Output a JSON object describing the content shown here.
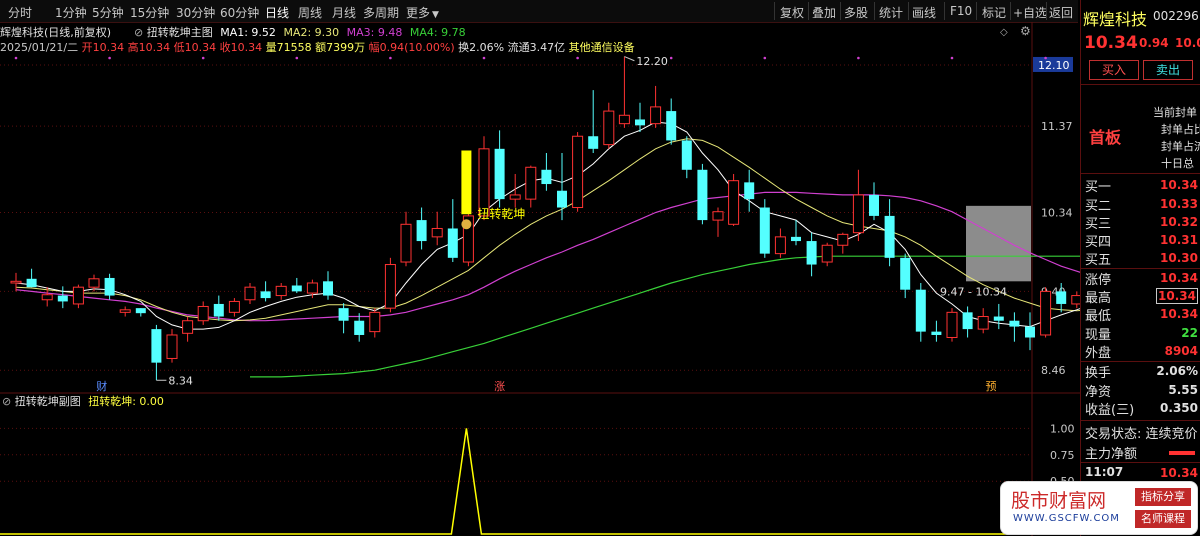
{
  "toolbar": {
    "periods": [
      "分时",
      "1分钟",
      "5分钟",
      "15分钟",
      "30分钟",
      "60分钟",
      "日线",
      "周线",
      "月线",
      "多周期",
      "更多"
    ],
    "active_period": "日线",
    "tools": [
      "复权",
      "叠加",
      "多股",
      "统计",
      "画线",
      "F10",
      "标记",
      "+自选",
      "返回"
    ]
  },
  "info": {
    "name_line": "辉煌科技(日线,前复权)",
    "date": "2025/01/21/二",
    "open": "开10.34",
    "high": "高10.34",
    "low": "低10.34",
    "close": "收10.34",
    "volume": "量71558",
    "amount": "额7399万",
    "change": "幅0.94(10.00%)",
    "turnover": "换2.06%",
    "float": "流通3.47亿",
    "sector": "其他通信设备"
  },
  "main_indicator": {
    "name": "扭转乾坤主图",
    "ma1": "MA1: 9.52",
    "ma2": "MA2: 9.30",
    "ma3": "MA3: 9.48",
    "ma4": "MA4: 9.78"
  },
  "sub_indicator": {
    "name": "扭转乾坤副图",
    "value_label": "扭转乾坤: 0.00"
  },
  "colors": {
    "up": "#ff3232",
    "down": "#54ffff",
    "ma1": "#ffffff",
    "ma2": "#e6e678",
    "ma3": "#d040d0",
    "ma4": "#38d038",
    "signal": "#ffff00",
    "grid": "#5a0f0f",
    "axis_text": "#c8c8c8"
  },
  "chart_data": {
    "type": "candlestick",
    "y_ticks": [
      "12.10",
      "11.37",
      "10.34",
      "9.40",
      "8.46"
    ],
    "y_tick_values": [
      12.1,
      11.37,
      10.34,
      9.4,
      8.46
    ],
    "ylim": [
      8.2,
      12.35
    ],
    "last_price_label": "12.10",
    "high_annotation": "12.20",
    "low_annotation": "8.34",
    "range_annotation": "9.47 - 10.34",
    "signal_label": "扭转乾坤",
    "event_markers": [
      "财",
      "涨",
      "预"
    ],
    "candles": [
      {
        "o": 9.5,
        "h": 9.62,
        "l": 9.4,
        "c": 9.52
      },
      {
        "o": 9.55,
        "h": 9.67,
        "l": 9.45,
        "c": 9.45
      },
      {
        "o": 9.3,
        "h": 9.45,
        "l": 9.22,
        "c": 9.36
      },
      {
        "o": 9.35,
        "h": 9.46,
        "l": 9.2,
        "c": 9.28
      },
      {
        "o": 9.25,
        "h": 9.48,
        "l": 9.2,
        "c": 9.45
      },
      {
        "o": 9.45,
        "h": 9.6,
        "l": 9.4,
        "c": 9.55
      },
      {
        "o": 9.56,
        "h": 9.61,
        "l": 9.3,
        "c": 9.35
      },
      {
        "o": 9.15,
        "h": 9.22,
        "l": 9.1,
        "c": 9.18
      },
      {
        "o": 9.2,
        "h": 9.2,
        "l": 9.1,
        "c": 9.14
      },
      {
        "o": 8.95,
        "h": 9.0,
        "l": 8.34,
        "c": 8.55
      },
      {
        "o": 8.6,
        "h": 8.95,
        "l": 8.55,
        "c": 8.88
      },
      {
        "o": 8.9,
        "h": 9.1,
        "l": 8.8,
        "c": 9.05
      },
      {
        "o": 9.05,
        "h": 9.28,
        "l": 9.0,
        "c": 9.22
      },
      {
        "o": 9.25,
        "h": 9.35,
        "l": 9.05,
        "c": 9.1
      },
      {
        "o": 9.15,
        "h": 9.32,
        "l": 9.1,
        "c": 9.28
      },
      {
        "o": 9.3,
        "h": 9.5,
        "l": 9.25,
        "c": 9.45
      },
      {
        "o": 9.4,
        "h": 9.52,
        "l": 9.28,
        "c": 9.32
      },
      {
        "o": 9.35,
        "h": 9.5,
        "l": 9.3,
        "c": 9.46
      },
      {
        "o": 9.47,
        "h": 9.56,
        "l": 9.38,
        "c": 9.4
      },
      {
        "o": 9.38,
        "h": 9.54,
        "l": 9.32,
        "c": 9.5
      },
      {
        "o": 9.52,
        "h": 9.64,
        "l": 9.3,
        "c": 9.35
      },
      {
        "o": 9.2,
        "h": 9.26,
        "l": 8.9,
        "c": 9.05
      },
      {
        "o": 9.05,
        "h": 9.14,
        "l": 8.8,
        "c": 8.88
      },
      {
        "o": 8.92,
        "h": 9.2,
        "l": 8.85,
        "c": 9.15
      },
      {
        "o": 9.2,
        "h": 9.8,
        "l": 9.15,
        "c": 9.72
      },
      {
        "o": 9.75,
        "h": 10.35,
        "l": 9.7,
        "c": 10.2
      },
      {
        "o": 10.25,
        "h": 10.4,
        "l": 9.9,
        "c": 10.0
      },
      {
        "o": 10.05,
        "h": 10.35,
        "l": 9.95,
        "c": 10.15
      },
      {
        "o": 10.15,
        "h": 10.5,
        "l": 9.75,
        "c": 9.8
      },
      {
        "o": 9.75,
        "h": 10.5,
        "l": 9.7,
        "c": 10.3
      },
      {
        "o": 10.3,
        "h": 11.25,
        "l": 10.25,
        "c": 11.1
      },
      {
        "o": 11.1,
        "h": 11.32,
        "l": 10.4,
        "c": 10.5
      },
      {
        "o": 10.5,
        "h": 10.8,
        "l": 10.4,
        "c": 10.55
      },
      {
        "o": 10.5,
        "h": 10.9,
        "l": 10.4,
        "c": 10.88
      },
      {
        "o": 10.85,
        "h": 11.05,
        "l": 10.6,
        "c": 10.68
      },
      {
        "o": 10.6,
        "h": 11.05,
        "l": 10.25,
        "c": 10.4
      },
      {
        "o": 10.4,
        "h": 11.3,
        "l": 10.35,
        "c": 11.25
      },
      {
        "o": 11.25,
        "h": 11.8,
        "l": 11.05,
        "c": 11.1
      },
      {
        "o": 11.15,
        "h": 11.65,
        "l": 11.1,
        "c": 11.55
      },
      {
        "o": 11.4,
        "h": 12.2,
        "l": 11.35,
        "c": 11.5
      },
      {
        "o": 11.45,
        "h": 11.65,
        "l": 11.3,
        "c": 11.38
      },
      {
        "o": 11.4,
        "h": 11.85,
        "l": 11.35,
        "c": 11.6
      },
      {
        "o": 11.55,
        "h": 11.7,
        "l": 11.15,
        "c": 11.2
      },
      {
        "o": 11.2,
        "h": 11.25,
        "l": 10.75,
        "c": 10.85
      },
      {
        "o": 10.85,
        "h": 10.92,
        "l": 10.2,
        "c": 10.25
      },
      {
        "o": 10.25,
        "h": 10.4,
        "l": 10.05,
        "c": 10.35
      },
      {
        "o": 10.2,
        "h": 10.8,
        "l": 10.18,
        "c": 10.72
      },
      {
        "o": 10.7,
        "h": 10.85,
        "l": 10.35,
        "c": 10.5
      },
      {
        "o": 10.4,
        "h": 10.5,
        "l": 9.8,
        "c": 9.85
      },
      {
        "o": 9.85,
        "h": 10.15,
        "l": 9.8,
        "c": 10.05
      },
      {
        "o": 10.05,
        "h": 10.25,
        "l": 9.95,
        "c": 10.0
      },
      {
        "o": 10.0,
        "h": 10.1,
        "l": 9.58,
        "c": 9.72
      },
      {
        "o": 9.75,
        "h": 9.98,
        "l": 9.7,
        "c": 9.95
      },
      {
        "o": 9.95,
        "h": 10.1,
        "l": 9.85,
        "c": 10.08
      },
      {
        "o": 10.1,
        "h": 10.85,
        "l": 10.0,
        "c": 10.55
      },
      {
        "o": 10.55,
        "h": 10.7,
        "l": 10.25,
        "c": 10.3
      },
      {
        "o": 10.3,
        "h": 10.5,
        "l": 9.7,
        "c": 9.8
      },
      {
        "o": 9.8,
        "h": 9.85,
        "l": 9.32,
        "c": 9.42
      },
      {
        "o": 9.42,
        "h": 9.5,
        "l": 8.8,
        "c": 8.92
      },
      {
        "o": 8.92,
        "h": 9.05,
        "l": 8.8,
        "c": 8.88
      },
      {
        "o": 8.85,
        "h": 9.2,
        "l": 8.8,
        "c": 9.15
      },
      {
        "o": 9.15,
        "h": 9.22,
        "l": 8.85,
        "c": 8.95
      },
      {
        "o": 8.95,
        "h": 9.2,
        "l": 8.9,
        "c": 9.1
      },
      {
        "o": 9.1,
        "h": 9.25,
        "l": 8.95,
        "c": 9.05
      },
      {
        "o": 9.05,
        "h": 9.15,
        "l": 8.8,
        "c": 8.98
      },
      {
        "o": 8.98,
        "h": 9.15,
        "l": 8.7,
        "c": 8.85
      },
      {
        "o": 8.88,
        "h": 9.45,
        "l": 8.85,
        "c": 9.4
      },
      {
        "o": 9.4,
        "h": 9.5,
        "l": 9.15,
        "c": 9.25
      },
      {
        "o": 9.25,
        "h": 9.4,
        "l": 9.2,
        "c": 9.35
      },
      {
        "o": 9.35,
        "h": 9.42,
        "l": 9.25,
        "c": 9.3
      },
      {
        "o": 9.3,
        "h": 9.45,
        "l": 9.25,
        "c": 9.42
      },
      {
        "o": 9.4,
        "h": 9.55,
        "l": 9.4,
        "c": 9.47
      }
    ],
    "ma1": [
      9.5,
      9.48,
      9.44,
      9.4,
      9.4,
      9.43,
      9.42,
      9.36,
      9.28,
      9.1,
      9.0,
      8.95,
      8.95,
      8.97,
      9.05,
      9.15,
      9.22,
      9.28,
      9.33,
      9.36,
      9.38,
      9.32,
      9.22,
      9.17,
      9.26,
      9.5,
      9.72,
      9.9,
      9.98,
      10.08,
      10.35,
      10.5,
      10.62,
      10.72,
      10.75,
      10.7,
      10.78,
      10.92,
      11.1,
      11.25,
      11.32,
      11.42,
      11.4,
      11.3,
      11.05,
      10.85,
      10.6,
      10.48,
      10.35,
      10.3,
      10.25,
      10.1,
      10.05,
      10.0,
      10.08,
      10.2,
      10.1,
      9.9,
      9.6,
      9.38,
      9.25,
      9.1,
      9.05,
      9.02,
      9.0,
      8.98,
      9.05,
      9.12,
      9.18,
      9.25,
      9.32,
      9.4
    ],
    "ma2": [
      9.45,
      9.44,
      9.42,
      9.4,
      9.38,
      9.38,
      9.38,
      9.35,
      9.3,
      9.22,
      9.15,
      9.1,
      9.08,
      9.06,
      9.05,
      9.06,
      9.08,
      9.12,
      9.16,
      9.2,
      9.24,
      9.24,
      9.22,
      9.2,
      9.2,
      9.26,
      9.35,
      9.45,
      9.55,
      9.65,
      9.8,
      9.95,
      10.08,
      10.2,
      10.3,
      10.38,
      10.48,
      10.6,
      10.72,
      10.85,
      10.98,
      11.1,
      11.18,
      11.22,
      11.2,
      11.12,
      11.0,
      10.88,
      10.75,
      10.62,
      10.5,
      10.4,
      10.3,
      10.22,
      10.18,
      10.15,
      10.12,
      10.05,
      9.95,
      9.82,
      9.7,
      9.58,
      9.48,
      9.4,
      9.32,
      9.26,
      9.2,
      9.18,
      9.17,
      9.18,
      9.2,
      9.25
    ],
    "ma3": [
      9.42,
      9.4,
      9.38,
      9.36,
      9.34,
      9.32,
      9.3,
      9.28,
      9.25,
      9.2,
      9.16,
      9.12,
      9.1,
      9.08,
      9.06,
      9.05,
      9.05,
      9.06,
      9.07,
      9.08,
      9.09,
      9.1,
      9.1,
      9.1,
      9.12,
      9.15,
      9.2,
      9.25,
      9.3,
      9.36,
      9.45,
      9.55,
      9.64,
      9.72,
      9.8,
      9.87,
      9.95,
      10.02,
      10.1,
      10.18,
      10.26,
      10.34,
      10.4,
      10.45,
      10.5,
      10.52,
      10.54,
      10.56,
      10.58,
      10.58,
      10.58,
      10.57,
      10.56,
      10.55,
      10.55,
      10.55,
      10.54,
      10.52,
      10.48,
      10.42,
      10.35,
      10.25,
      10.15,
      10.05,
      9.95,
      9.86,
      9.78,
      9.7,
      9.64,
      9.58,
      9.54,
      9.5
    ],
    "ma4_start_index": 15,
    "ma4": [
      8.38,
      8.38,
      8.38,
      8.39,
      8.4,
      8.41,
      8.42,
      8.44,
      8.46,
      8.5,
      8.54,
      8.58,
      8.63,
      8.68,
      8.73,
      8.78,
      8.84,
      8.9,
      8.96,
      9.02,
      9.08,
      9.14,
      9.2,
      9.26,
      9.32,
      9.38,
      9.44,
      9.5,
      9.55,
      9.6,
      9.64,
      9.68,
      9.72,
      9.75,
      9.78,
      9.8,
      9.81,
      9.82,
      9.82,
      9.82,
      9.82,
      9.82,
      9.82,
      9.82,
      9.82,
      9.82,
      9.82,
      9.82,
      9.82,
      9.82,
      9.82,
      9.82,
      9.82,
      9.82,
      9.82,
      9.82,
      9.83
    ],
    "signal_index": 29,
    "signal_bar": {
      "top": 11.08,
      "bottom": 10.32
    },
    "sub_y_ticks": [
      "1.00",
      "0.75",
      "0.50"
    ],
    "sub_ylim": [
      0,
      1.25
    ],
    "sub_series": {
      "name": "扭转乾坤",
      "peak_index": 29,
      "peak_value": 1.0
    }
  },
  "quote": {
    "name": "辉煌科技",
    "code": "002296",
    "price": "10.34",
    "change": "0.94",
    "pct": "10.00%",
    "buy_label": "买入",
    "sell_label": "卖出",
    "board": "首板",
    "notes": [
      "当前封单",
      "封单占比",
      "封单占流",
      "十日总"
    ],
    "bids": [
      {
        "label": "买一",
        "value": "10.34"
      },
      {
        "label": "买二",
        "value": "10.33"
      },
      {
        "label": "买三",
        "value": "10.32"
      },
      {
        "label": "买四",
        "value": "10.31"
      },
      {
        "label": "买五",
        "value": "10.30"
      }
    ],
    "stats": [
      {
        "label": "涨停",
        "value": "10.34"
      },
      {
        "label": "最高",
        "value": "10.34"
      },
      {
        "label": "最低",
        "value": "10.34"
      },
      {
        "label": "现量",
        "value": "22"
      },
      {
        "label": "外盘",
        "value": "8904"
      }
    ],
    "stats2": [
      {
        "label": "换手",
        "value": "2.06%"
      },
      {
        "label": "净资",
        "value": "5.55"
      },
      {
        "label": "收益(三)",
        "value": "0.350"
      }
    ],
    "trade_status": "交易状态: 连续竞价",
    "net_inflow": "主力净额",
    "tick_time": "11:07",
    "tick_price": "10.34"
  },
  "watermark": {
    "title": "股市财富网",
    "url": "WWW.GSCFW.COM",
    "tag1": "指标分享",
    "tag2": "名师课程"
  }
}
